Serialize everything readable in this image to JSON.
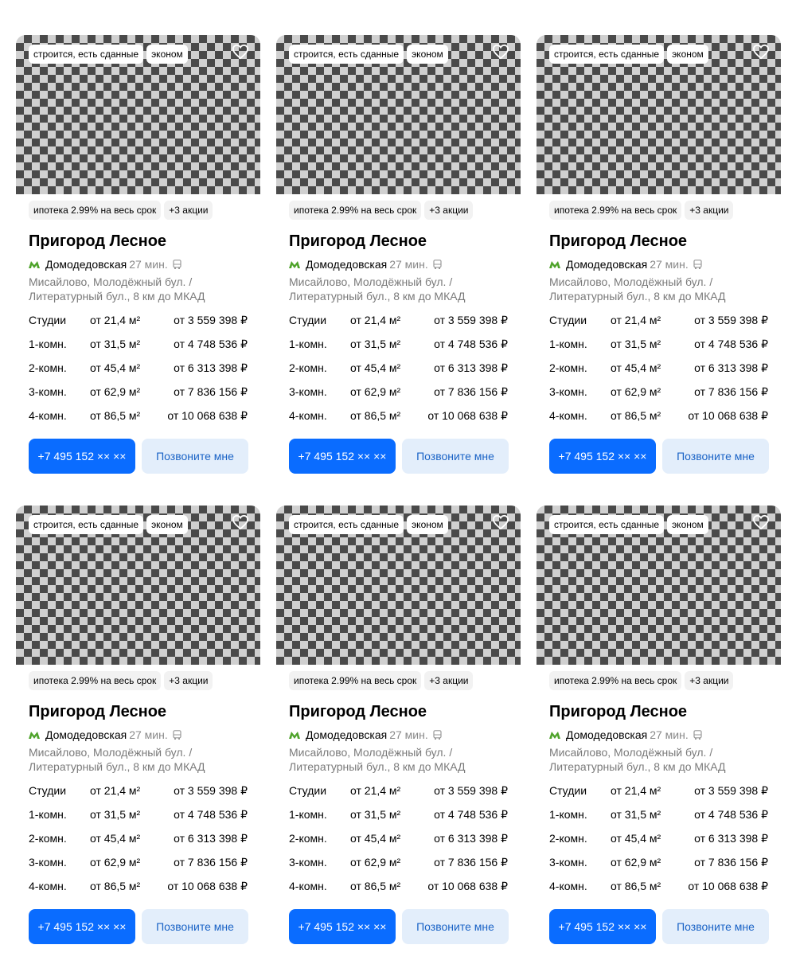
{
  "colors": {
    "primary_button": "#0a6cff",
    "secondary_button": "#e3eefb",
    "secondary_text": "#1a63c6",
    "metro_line": "#4ea32a"
  },
  "cards": [
    {
      "tags": [
        "строится, есть сданные",
        "эконом"
      ],
      "promos": [
        "ипотека 2.99% на весь срок",
        "+3 акции"
      ],
      "title": "Пригород Лесное",
      "metro": {
        "station": "Домодедовская",
        "time": "27 мин.",
        "transport": "bus-icon"
      },
      "address": "Мисайлово, Молодёжный бул. / Литературный бул., 8 км до МКАД",
      "rooms": [
        {
          "type": "Студии",
          "area": "от 21,4 м²",
          "price": "от 3 559 398 ₽"
        },
        {
          "type": "1-комн.",
          "area": "от 31,5 м²",
          "price": "от 4 748 536 ₽"
        },
        {
          "type": "2-комн.",
          "area": "от 45,4 м²",
          "price": "от 6 313 398 ₽"
        },
        {
          "type": "3-комн.",
          "area": "от 62,9 м²",
          "price": "от 7 836 156 ₽"
        },
        {
          "type": "4-комн.",
          "area": "от 86,5 м²",
          "price": "от 10 068 638 ₽"
        }
      ],
      "phone_label": "+7 495 152 ×× ××",
      "callback_label": "Позвоните мне"
    },
    {
      "tags": [
        "строится, есть сданные",
        "эконом"
      ],
      "promos": [
        "ипотека 2.99% на весь срок",
        "+3 акции"
      ],
      "title": "Пригород Лесное",
      "metro": {
        "station": "Домодедовская",
        "time": "27 мин.",
        "transport": "bus-icon"
      },
      "address": "Мисайлово, Молодёжный бул. / Литературный бул., 8 км до МКАД",
      "rooms": [
        {
          "type": "Студии",
          "area": "от 21,4 м²",
          "price": "от 3 559 398 ₽"
        },
        {
          "type": "1-комн.",
          "area": "от 31,5 м²",
          "price": "от 4 748 536 ₽"
        },
        {
          "type": "2-комн.",
          "area": "от 45,4 м²",
          "price": "от 6 313 398 ₽"
        },
        {
          "type": "3-комн.",
          "area": "от 62,9 м²",
          "price": "от 7 836 156 ₽"
        },
        {
          "type": "4-комн.",
          "area": "от 86,5 м²",
          "price": "от 10 068 638 ₽"
        }
      ],
      "phone_label": "+7 495 152 ×× ××",
      "callback_label": "Позвоните мне"
    },
    {
      "tags": [
        "строится, есть сданные",
        "эконом"
      ],
      "promos": [
        "ипотека 2.99% на весь срок",
        "+3 акции"
      ],
      "title": "Пригород Лесное",
      "metro": {
        "station": "Домодедовская",
        "time": "27 мин.",
        "transport": "bus-icon"
      },
      "address": "Мисайлово, Молодёжный бул. / Литературный бул., 8 км до МКАД",
      "rooms": [
        {
          "type": "Студии",
          "area": "от 21,4 м²",
          "price": "от 3 559 398 ₽"
        },
        {
          "type": "1-комн.",
          "area": "от 31,5 м²",
          "price": "от 4 748 536 ₽"
        },
        {
          "type": "2-комн.",
          "area": "от 45,4 м²",
          "price": "от 6 313 398 ₽"
        },
        {
          "type": "3-комн.",
          "area": "от 62,9 м²",
          "price": "от 7 836 156 ₽"
        },
        {
          "type": "4-комн.",
          "area": "от 86,5 м²",
          "price": "от 10 068 638 ₽"
        }
      ],
      "phone_label": "+7 495 152 ×× ××",
      "callback_label": "Позвоните мне"
    },
    {
      "tags": [
        "строится, есть сданные",
        "эконом"
      ],
      "promos": [
        "ипотека 2.99% на весь срок",
        "+3 акции"
      ],
      "title": "Пригород Лесное",
      "metro": {
        "station": "Домодедовская",
        "time": "27 мин.",
        "transport": "bus-icon"
      },
      "address": "Мисайлово, Молодёжный бул. / Литературный бул., 8 км до МКАД",
      "rooms": [
        {
          "type": "Студии",
          "area": "от 21,4 м²",
          "price": "от 3 559 398 ₽"
        },
        {
          "type": "1-комн.",
          "area": "от 31,5 м²",
          "price": "от 4 748 536 ₽"
        },
        {
          "type": "2-комн.",
          "area": "от 45,4 м²",
          "price": "от 6 313 398 ₽"
        },
        {
          "type": "3-комн.",
          "area": "от 62,9 м²",
          "price": "от 7 836 156 ₽"
        },
        {
          "type": "4-комн.",
          "area": "от 86,5 м²",
          "price": "от 10 068 638 ₽"
        }
      ],
      "phone_label": "+7 495 152 ×× ××",
      "callback_label": "Позвоните мне"
    },
    {
      "tags": [
        "строится, есть сданные",
        "эконом"
      ],
      "promos": [
        "ипотека 2.99% на весь срок",
        "+3 акции"
      ],
      "title": "Пригород Лесное",
      "metro": {
        "station": "Домодедовская",
        "time": "27 мин.",
        "transport": "bus-icon"
      },
      "address": "Мисайлово, Молодёжный бул. / Литературный бул., 8 км до МКАД",
      "rooms": [
        {
          "type": "Студии",
          "area": "от 21,4 м²",
          "price": "от 3 559 398 ₽"
        },
        {
          "type": "1-комн.",
          "area": "от 31,5 м²",
          "price": "от 4 748 536 ₽"
        },
        {
          "type": "2-комн.",
          "area": "от 45,4 м²",
          "price": "от 6 313 398 ₽"
        },
        {
          "type": "3-комн.",
          "area": "от 62,9 м²",
          "price": "от 7 836 156 ₽"
        },
        {
          "type": "4-комн.",
          "area": "от 86,5 м²",
          "price": "от 10 068 638 ₽"
        }
      ],
      "phone_label": "+7 495 152 ×× ××",
      "callback_label": "Позвоните мне"
    },
    {
      "tags": [
        "строится, есть сданные",
        "эконом"
      ],
      "promos": [
        "ипотека 2.99% на весь срок",
        "+3 акции"
      ],
      "title": "Пригород Лесное",
      "metro": {
        "station": "Домодедовская",
        "time": "27 мин.",
        "transport": "bus-icon"
      },
      "address": "Мисайлово, Молодёжный бул. / Литературный бул., 8 км до МКАД",
      "rooms": [
        {
          "type": "Студии",
          "area": "от 21,4 м²",
          "price": "от 3 559 398 ₽"
        },
        {
          "type": "1-комн.",
          "area": "от 31,5 м²",
          "price": "от 4 748 536 ₽"
        },
        {
          "type": "2-комн.",
          "area": "от 45,4 м²",
          "price": "от 6 313 398 ₽"
        },
        {
          "type": "3-комн.",
          "area": "от 62,9 м²",
          "price": "от 7 836 156 ₽"
        },
        {
          "type": "4-комн.",
          "area": "от 86,5 м²",
          "price": "от 10 068 638 ₽"
        }
      ],
      "phone_label": "+7 495 152 ×× ××",
      "callback_label": "Позвоните мне"
    }
  ]
}
